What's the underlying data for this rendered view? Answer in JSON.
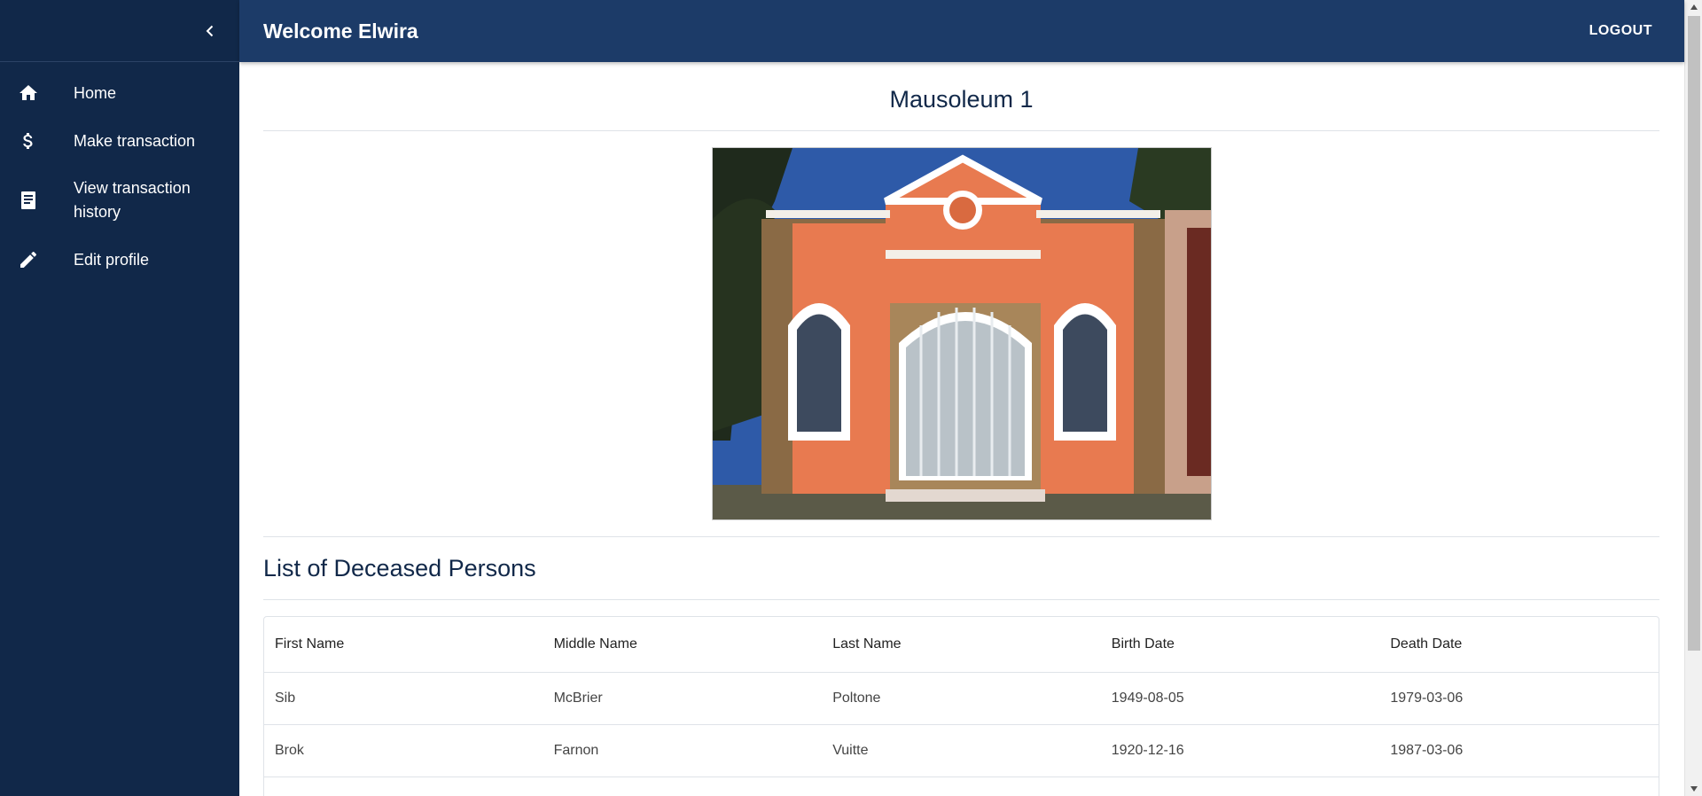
{
  "header": {
    "title": "Welcome Elwira",
    "logout_label": "LOGOUT"
  },
  "sidebar": {
    "items": [
      {
        "label": "Home",
        "icon": "home-icon"
      },
      {
        "label": "Make transaction",
        "icon": "dollar-icon"
      },
      {
        "label": "View transaction history",
        "icon": "receipt-icon"
      },
      {
        "label": "Edit profile",
        "icon": "pencil-icon"
      }
    ]
  },
  "main": {
    "title": "Mausoleum 1",
    "list_title": "List of Deceased Persons",
    "table": {
      "columns": [
        "First Name",
        "Middle Name",
        "Last Name",
        "Birth Date",
        "Death Date"
      ],
      "rows": [
        [
          "Sib",
          "McBrier",
          "Poltone",
          "1949-08-05",
          "1979-03-06"
        ],
        [
          "Brok",
          "Farnon",
          "Vuitte",
          "1920-12-16",
          "1987-03-06"
        ]
      ]
    }
  },
  "colors": {
    "sidebar": "#112849",
    "header": "#1c3b68",
    "accent_text": "#112849"
  }
}
